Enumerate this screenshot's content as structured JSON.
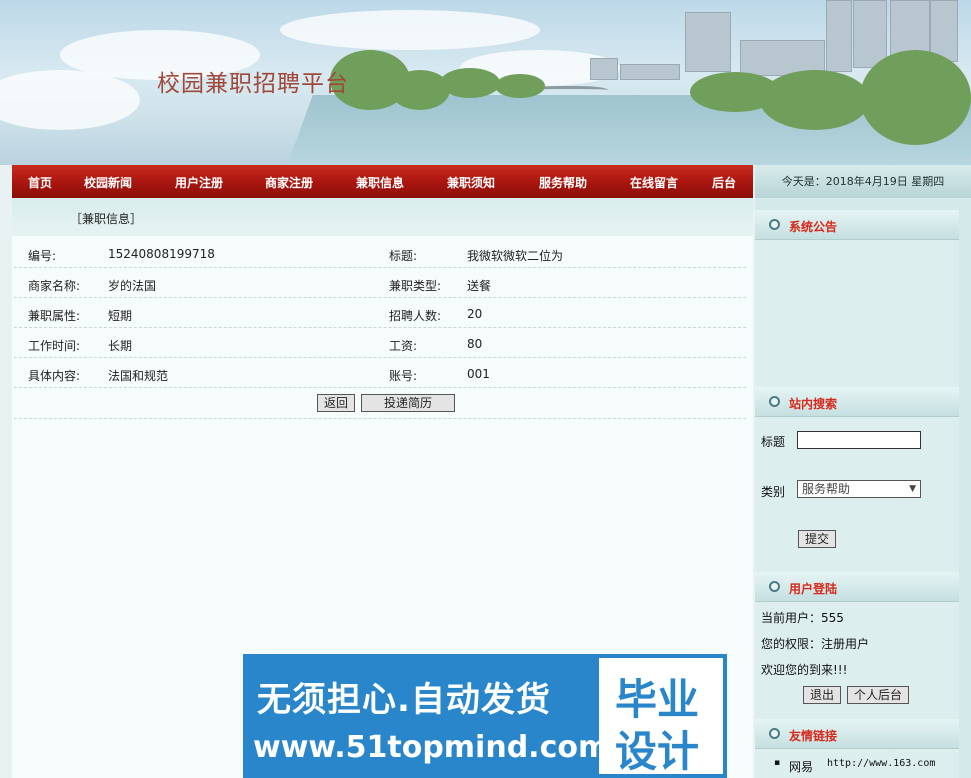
{
  "site": {
    "title": "校园兼职招聘平台"
  },
  "nav": {
    "items": [
      "首页",
      "校园新闻",
      "用户注册",
      "商家注册",
      "兼职信息",
      "兼职须知",
      "服务帮助",
      "在线留言",
      "后台"
    ],
    "date": "今天是：2018年4月19日 星期四"
  },
  "main": {
    "breadcrumb": "［兼职信息］",
    "rows": [
      {
        "l1": "编号:",
        "v1": "15240808199718",
        "l2": "标题:",
        "v2": "我微软微软二位为"
      },
      {
        "l1": "商家名称:",
        "v1": "岁的法国",
        "l2": "兼职类型:",
        "v2": "送餐"
      },
      {
        "l1": "兼职属性:",
        "v1": "短期",
        "l2": "招聘人数:",
        "v2": "20"
      },
      {
        "l1": "工作时间:",
        "v1": "长期",
        "l2": "工资:",
        "v2": "80"
      },
      {
        "l1": "具体内容:",
        "v1": "法国和规范",
        "l2": "账号:",
        "v2": "001"
      }
    ],
    "back_label": "返回",
    "apply_label": "投递简历"
  },
  "sidebar": {
    "notice_title": "系统公告",
    "search_title": "站内搜索",
    "search_title_label": "标题",
    "search_title_value": "",
    "search_type_label": "类别",
    "search_type_value": "服务帮助",
    "submit_label": "提交",
    "login_title": "用户登陆",
    "current_user": "当前用户：555",
    "permission": "您的权限：注册用户",
    "welcome": "欢迎您的到来!!!",
    "logout_label": "退出",
    "personal_label": "个人后台",
    "links_title": "友情链接",
    "links": [
      {
        "name": "网易",
        "url": "http://www.163.com"
      }
    ]
  },
  "watermark": {
    "line1": "无须担心.自动发货",
    "line2": "www.51topmind.com",
    "box1": "毕业",
    "box2": "设计"
  }
}
